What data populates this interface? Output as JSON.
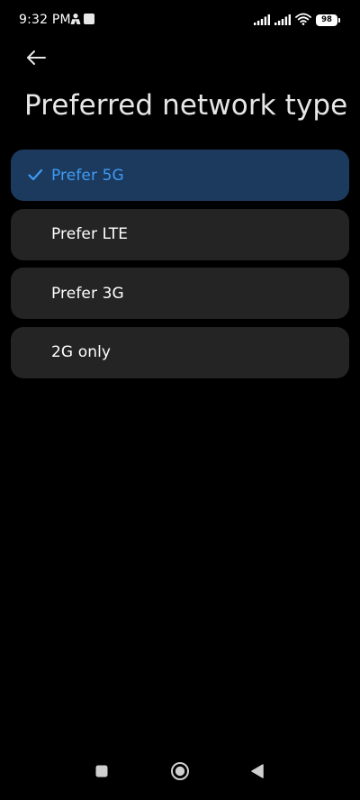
{
  "status_bar": {
    "time": "9:32 PM",
    "battery_level": "98",
    "icons": [
      "account-notification-icon",
      "square-notification-icon",
      "signal-icon",
      "signal-icon",
      "wifi-icon",
      "battery-icon"
    ]
  },
  "header": {
    "back_icon": "arrow-left-icon",
    "title": "Preferred network type"
  },
  "options": [
    {
      "label": "Prefer 5G",
      "selected": true
    },
    {
      "label": "Prefer LTE",
      "selected": false
    },
    {
      "label": "Prefer 3G",
      "selected": false
    },
    {
      "label": "2G only",
      "selected": false
    }
  ],
  "colors": {
    "background": "#000000",
    "option_background": "#242424",
    "selected_background": "#1b3a5e",
    "accent": "#3f9bf5",
    "text": "#ffffff"
  },
  "nav_bar": {
    "icons": [
      "recents-square-icon",
      "home-circle-icon",
      "back-triangle-icon"
    ]
  }
}
